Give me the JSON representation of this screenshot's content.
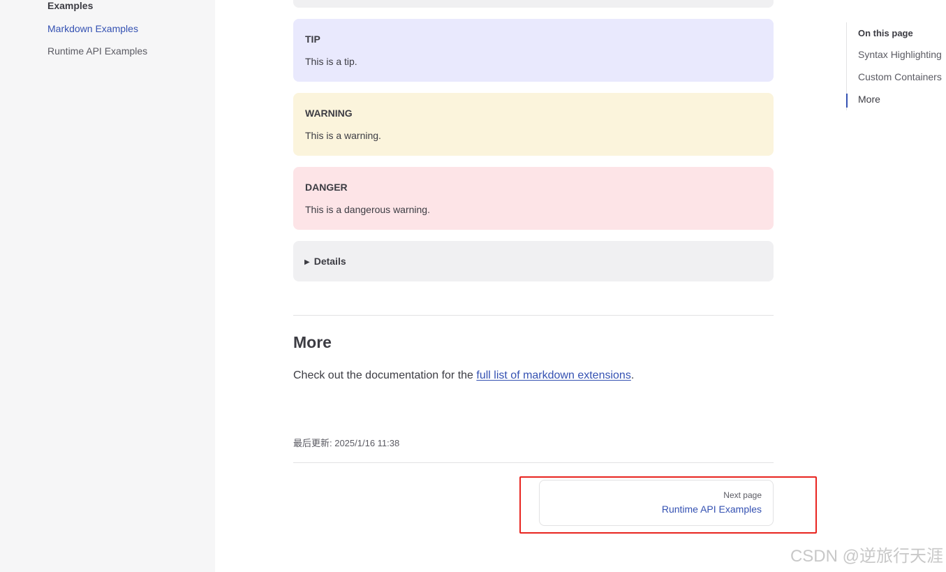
{
  "sidebar": {
    "section_title": "Examples",
    "items": [
      {
        "label": "Markdown Examples",
        "active": true
      },
      {
        "label": "Runtime API Examples",
        "active": false
      }
    ]
  },
  "containers": {
    "tip": {
      "title": "TIP",
      "text": "This is a tip."
    },
    "warning": {
      "title": "WARNING",
      "text": "This is a warning."
    },
    "danger": {
      "title": "DANGER",
      "text": "This is a dangerous warning."
    },
    "details": {
      "summary": "Details",
      "icon": "triangle-right-icon"
    }
  },
  "more_section": {
    "heading": "More",
    "text_before": "Check out the documentation for the ",
    "link_text": "full list of markdown extensions",
    "text_after": "."
  },
  "footer": {
    "last_updated": "最后更新: 2025/1/16 11:38",
    "next_page_label": "Next page",
    "next_page_title": "Runtime API Examples"
  },
  "outline": {
    "title": "On this page",
    "items": [
      {
        "label": "Syntax Highlighting",
        "active": false
      },
      {
        "label": "Custom Containers",
        "active": false
      },
      {
        "label": "More",
        "active": true
      }
    ]
  },
  "watermark": "CSDN @逆旅行天涯",
  "colors": {
    "brand": "#3451b2",
    "tip_bg": "#e9e9fd",
    "warning_bg": "#fbf4dc",
    "danger_bg": "#fde4e7",
    "details_bg": "#f0f0f2",
    "highlight_border": "#e8241f"
  }
}
